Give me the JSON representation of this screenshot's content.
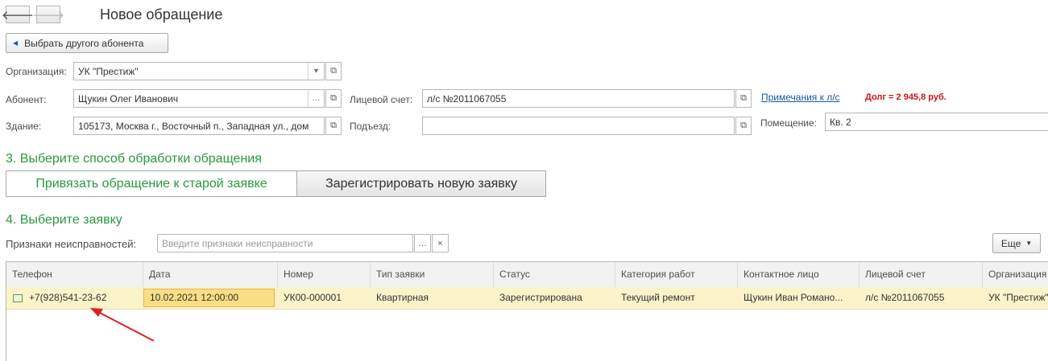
{
  "window": {
    "title": "Новое обращение"
  },
  "toolbar": {
    "select_other_label": "Выбрать другого абонента"
  },
  "form": {
    "organization": {
      "label": "Организация:",
      "value": "УК \"Престиж\""
    },
    "subscriber": {
      "label": "Абонент:",
      "value": "Щукин Олег Иванович"
    },
    "building": {
      "label": "Здание:",
      "value": "105173, Москва г., Восточный п., Западная ул., дом"
    },
    "account": {
      "label": "Лицевой счет:",
      "value": "л/с №2011067055"
    },
    "entrance": {
      "label": "Подъезд:",
      "value": ""
    },
    "premises": {
      "label": "Помещение:",
      "value": "Кв. 2"
    },
    "notes_link": "Примечания к л/с",
    "debt": "Долг = 2 945,8 руб."
  },
  "step3": {
    "title": "3. Выберите способ обработки обращения",
    "link_old": "Привязать обращение к старой заявке",
    "register_new": "Зарегистрировать новую заявку"
  },
  "step4": {
    "title": "4. Выберите заявку",
    "signs_label": "Признаки неисправностей:",
    "signs_placeholder": "Введите признаки неисправности",
    "more_label": "Еще"
  },
  "table": {
    "columns": [
      "Телефон",
      "Дата",
      "Номер",
      "Тип заявки",
      "Статус",
      "Категория работ",
      "Контактное лицо",
      "Лицевой счет",
      "Организация"
    ],
    "rows": [
      {
        "phone": "+7(928)541-23-62",
        "date": "10.02.2021 12:00:00",
        "number": "УК00-000001",
        "type": "Квартирная",
        "status": "Зарегистрирована",
        "category": "Текущий ремонт",
        "contact": "Щукин Иван Романо...",
        "account": "л/с №2011067055",
        "organization": "УК \"Престиж\""
      }
    ]
  },
  "colors": {
    "section_green": "#2a9a3d",
    "debt_red": "#d01414",
    "link_blue": "#1a5aa8",
    "row_highlight": "#fdf3c9",
    "annotation_arrow": "#e02020"
  }
}
